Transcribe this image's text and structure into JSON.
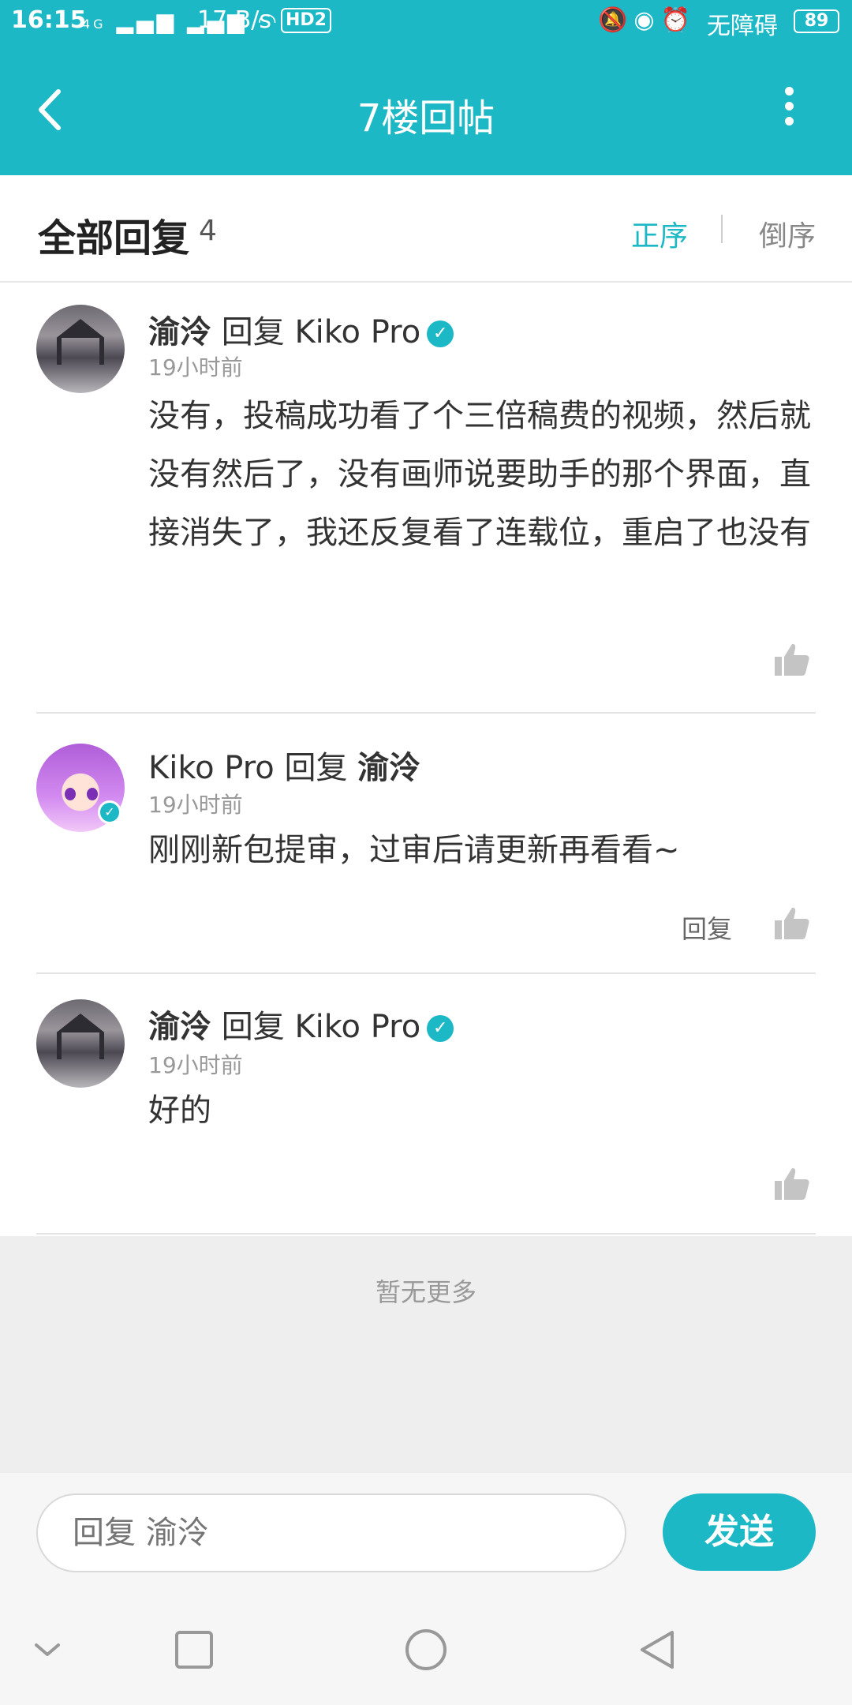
{
  "status_bar": {
    "time": "16:15",
    "signal": "4G",
    "speed": "17 B/s",
    "hd": "HD2",
    "mode": "无障碍",
    "battery": "89"
  },
  "topbar": {
    "title": "7楼回帖"
  },
  "header": {
    "title": "全部回复",
    "count": "4",
    "sort_asc": "正序",
    "sort_desc": "倒序"
  },
  "comments": [
    {
      "author": "渝泠",
      "reply_word": "回复",
      "target": "Kiko Pro",
      "time": "19小时前",
      "text": "没有，投稿成功看了个三倍稿费的视频，然后就没有然后了，没有画师说要助手的那个界面，直接消失了，我还反复看了连载位，重启了也没有",
      "reply_label": ""
    },
    {
      "author": "Kiko Pro",
      "reply_word": "回复",
      "target": "渝泠",
      "time": "19小时前",
      "text": "刚刚新包提审，过审后请更新再看看~",
      "reply_label": "回复"
    },
    {
      "author": "渝泠",
      "reply_word": "回复",
      "target": "Kiko Pro",
      "time": "19小时前",
      "text": "好的",
      "reply_label": ""
    }
  ],
  "footer": {
    "no_more": "暂无更多"
  },
  "reply_bar": {
    "placeholder": "回复 渝泠",
    "send_label": "发送"
  },
  "colors": {
    "accent": "#1cb8c6"
  }
}
